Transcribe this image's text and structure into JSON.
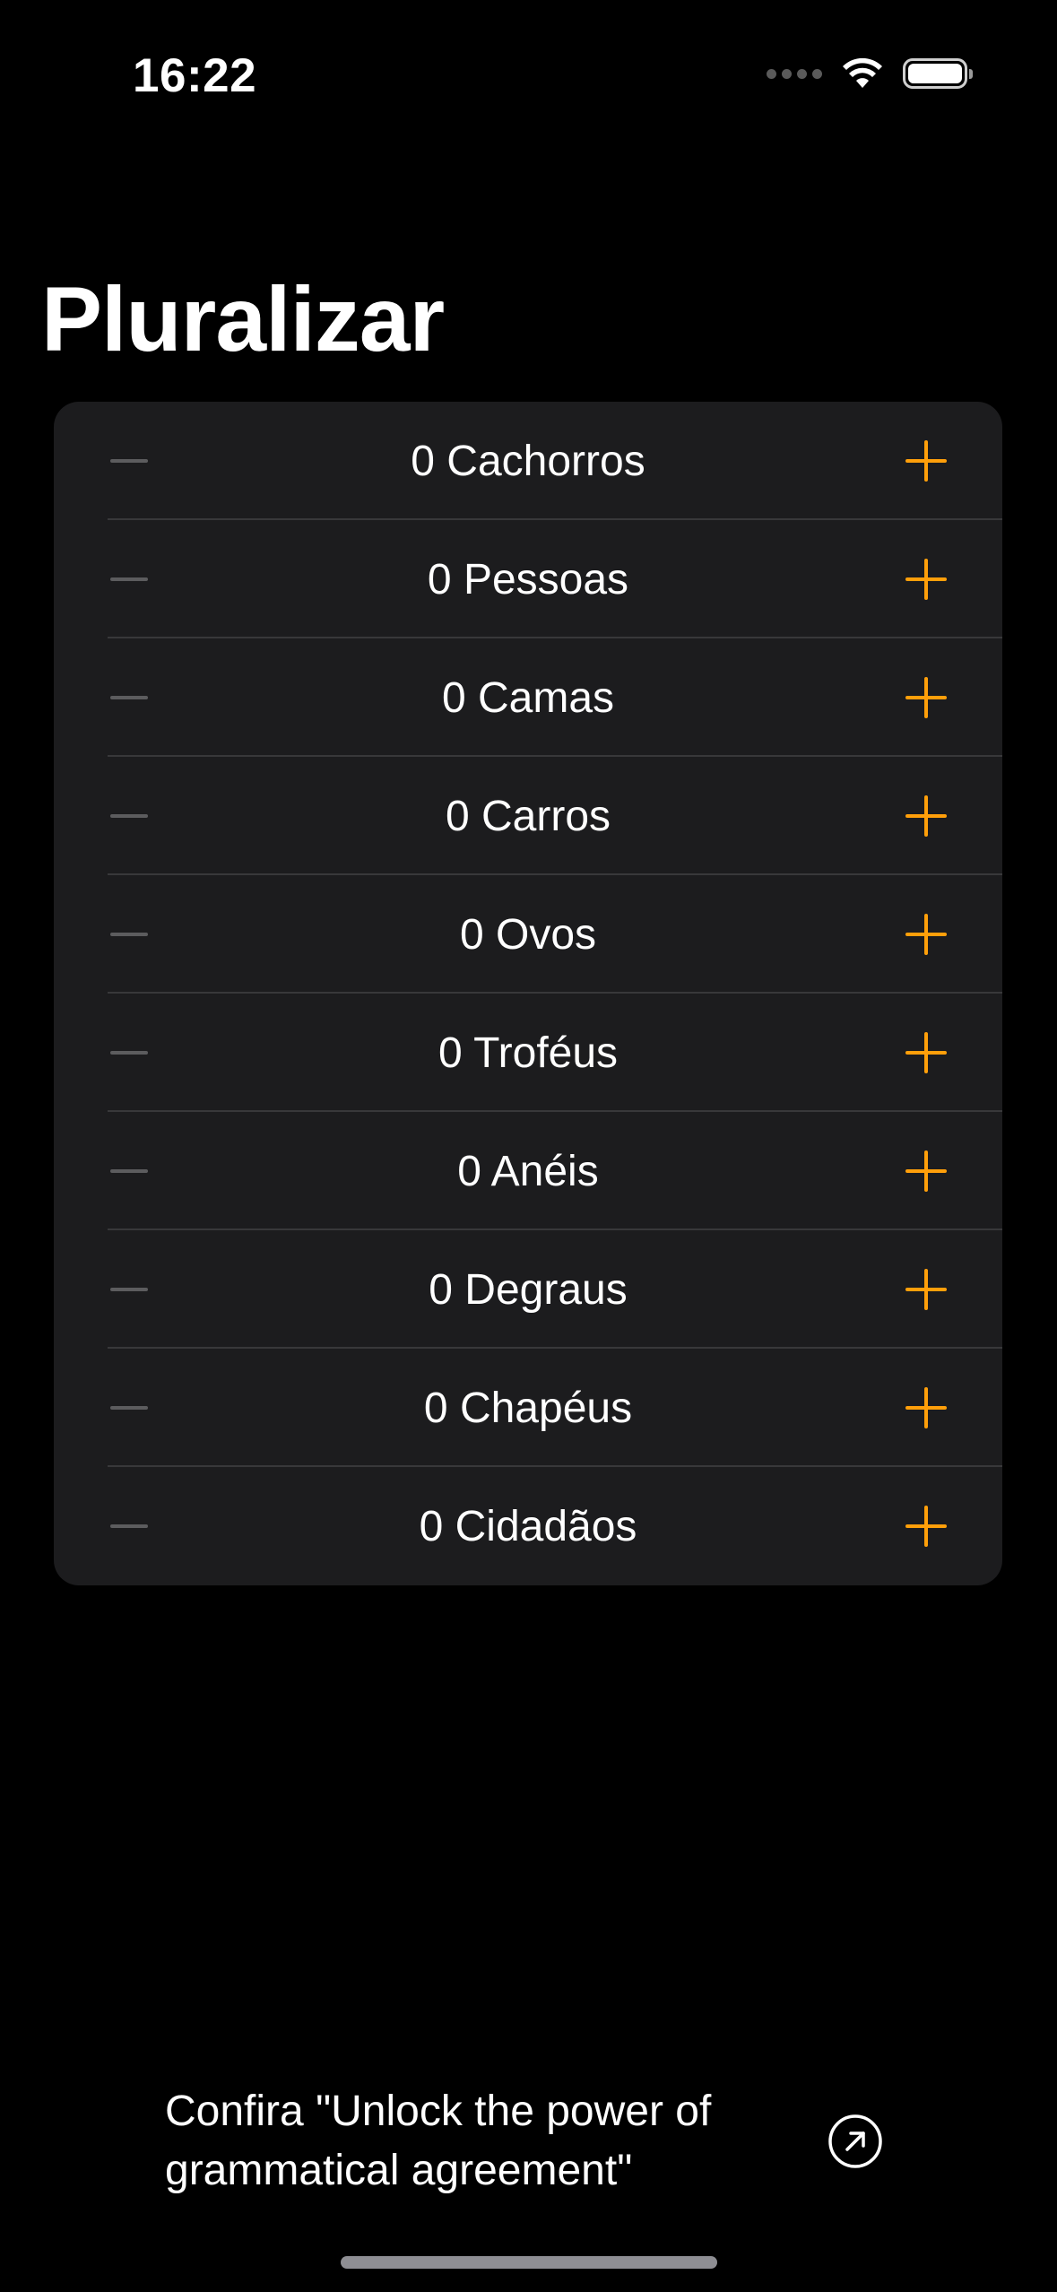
{
  "status_bar": {
    "time": "16:22",
    "icons": [
      "cellular-signal-icon",
      "wifi-icon",
      "battery-icon"
    ]
  },
  "page": {
    "title": "Pluralizar"
  },
  "counter_list": {
    "items": [
      {
        "label": "0 Cachorros"
      },
      {
        "label": "0 Pessoas"
      },
      {
        "label": "0 Camas"
      },
      {
        "label": "0 Carros"
      },
      {
        "label": "0 Ovos"
      },
      {
        "label": "0 Troféus"
      },
      {
        "label": "0 Anéis"
      },
      {
        "label": "0 Degraus"
      },
      {
        "label": "0 Chapéus"
      },
      {
        "label": "0 Cidadãos"
      }
    ],
    "decrement_icon": "minus-icon",
    "increment_icon": "plus-icon"
  },
  "promo": {
    "text": "Confira \"Unlock the power of grammatical agreement\"",
    "icon": "arrow-up-right-circle-icon"
  },
  "colors": {
    "background": "#000000",
    "card": "#1c1c1e",
    "accent": "#ff9f0a",
    "disabled": "#5c5c5e",
    "divider": "#38383a"
  }
}
